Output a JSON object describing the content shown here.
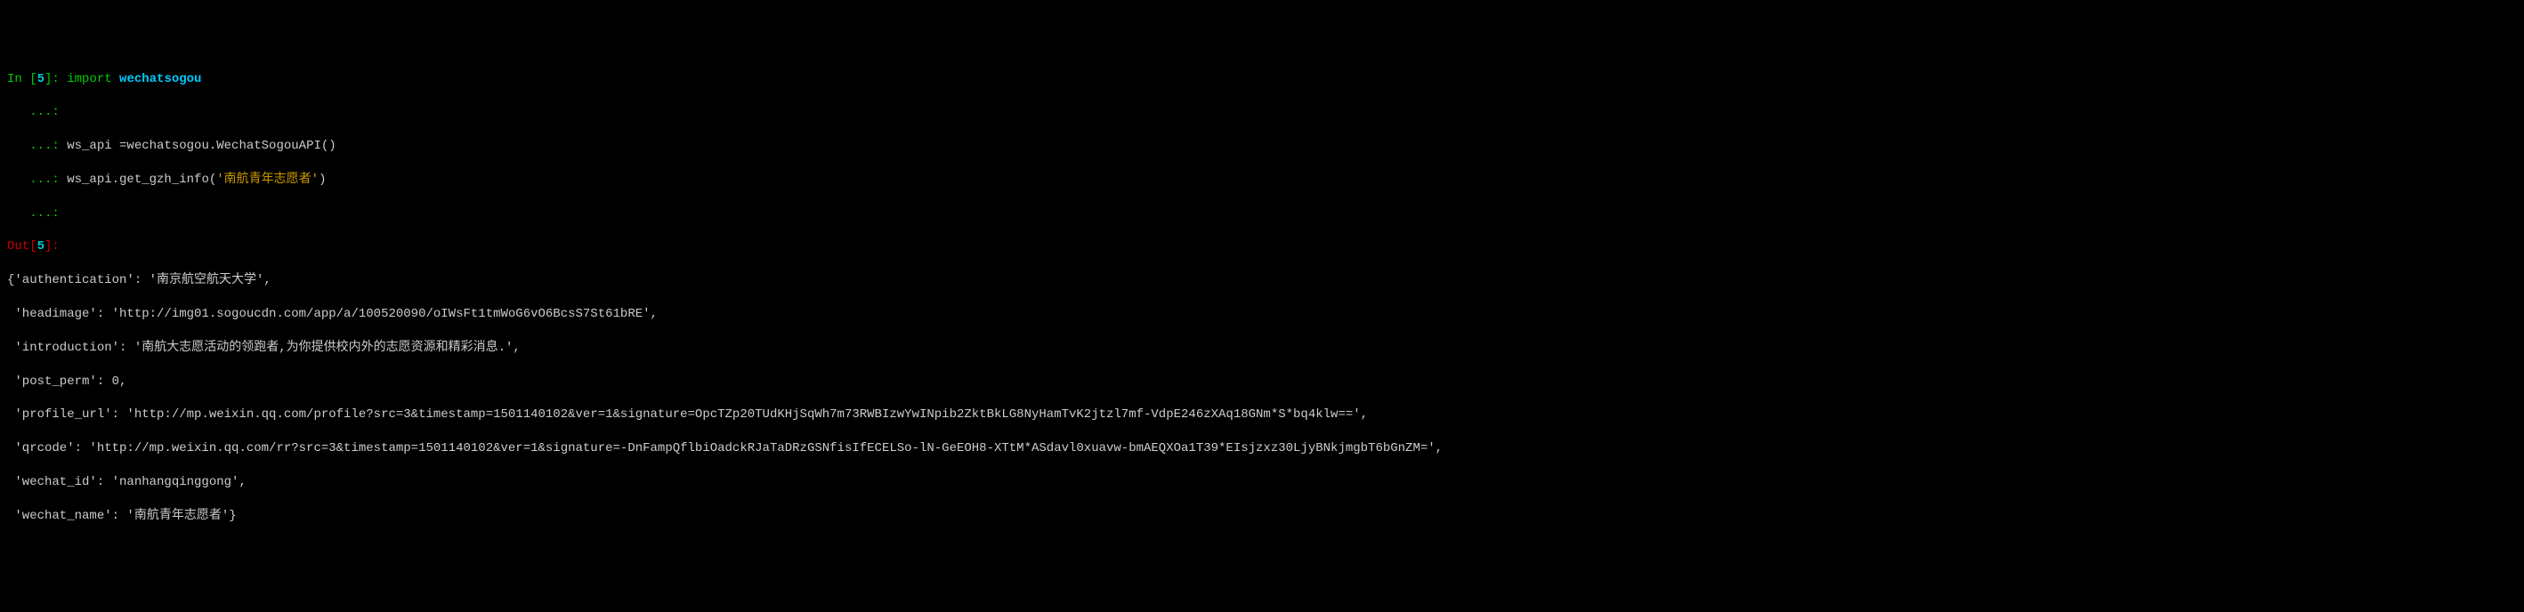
{
  "prompts": {
    "in_label": "In [",
    "in_num": "5",
    "in_close": "]: ",
    "cont": "   ...: ",
    "out_label": "Out[",
    "out_num": "5",
    "out_close": "]:"
  },
  "code": {
    "line1_kw": "import ",
    "line1_mod": "wechatsogou",
    "line2": "",
    "line3": "ws_api =wechatsogou.WechatSogouAPI()",
    "line4_pre": "ws_api.get_gzh_info(",
    "line4_str": "'南航青年志愿者'",
    "line4_post": ")",
    "line5": ""
  },
  "output": {
    "l1": "{'authentication': '南京航空航天大学',",
    "l2": " 'headimage': 'http://img01.sogoucdn.com/app/a/100520090/oIWsFt1tmWoG6vO6BcsS7St61bRE',",
    "l3": " 'introduction': '南航大志愿活动的领跑者,为你提供校内外的志愿资源和精彩消息.',",
    "l4": " 'post_perm': 0,",
    "l5": " 'profile_url': 'http://mp.weixin.qq.com/profile?src=3&timestamp=1501140102&ver=1&signature=OpcTZp20TUdKHjSqWh7m73RWBIzwYwINpib2ZktBkLG8NyHamTvK2jtzl7mf-VdpE246zXAq18GNm*S*bq4klw==',",
    "l6": " 'qrcode': 'http://mp.weixin.qq.com/rr?src=3&timestamp=1501140102&ver=1&signature=-DnFampQflbiOadckRJaTaDRzGSNfisIfECELSo-lN-GeEOH8-XTtM*ASdavl0xuavw-bmAEQXOa1T39*EIsjzxz30LjyBNkjmgbT6bGnZM=',",
    "l7": " 'wechat_id': 'nanhangqinggong',",
    "l8": " 'wechat_name': '南航青年志愿者'}"
  }
}
